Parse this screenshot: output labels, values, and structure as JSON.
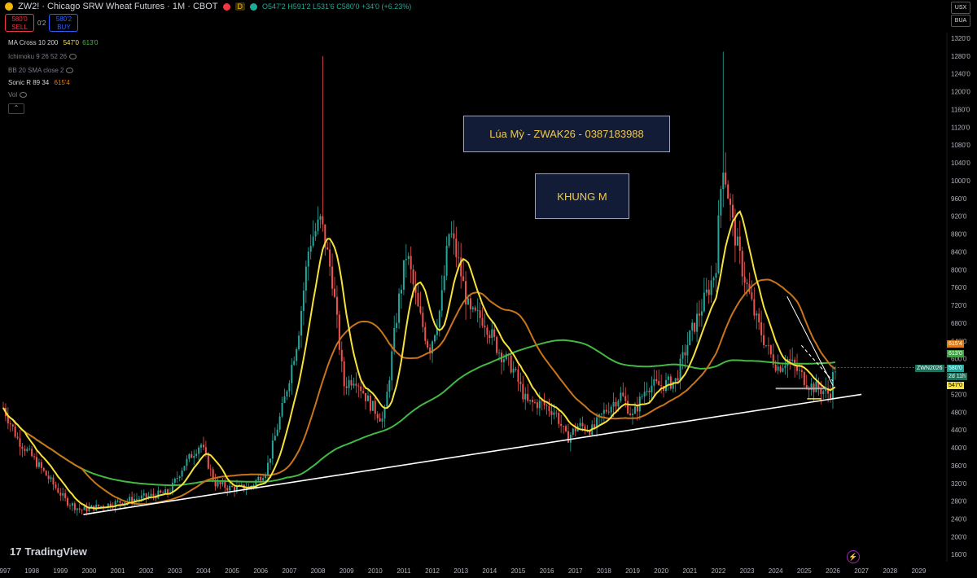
{
  "header": {
    "symbol": "ZW2! · Chicago SRW Wheat Futures · 1M · CBOT",
    "badge": "D",
    "ohlc": "O547'2 H591'2 L531'6 C580'0 +34'0 (+6.23%)"
  },
  "trade": {
    "sell_price": "580'0",
    "sell_label": "SELL",
    "spread": "0'2",
    "buy_price": "580'2",
    "buy_label": "BUY"
  },
  "indicators": [
    {
      "name": "MA Cross 10 200",
      "v1": "547'0",
      "v2": "613'0",
      "c1": "#f7e13b",
      "c2": "#43b845"
    },
    {
      "name": "Ichimoku 9 26 52 26",
      "v1": "",
      "v2": "",
      "c1": "",
      "c2": ""
    },
    {
      "name": "BB 20 SMA close 2",
      "v1": "",
      "v2": "",
      "c1": "",
      "c2": ""
    },
    {
      "name": "Sonic R 89 34",
      "v1": "615'4",
      "v2": "",
      "c1": "#e07b1a",
      "c2": ""
    },
    {
      "name": "Vol",
      "v1": "",
      "v2": "",
      "c1": "",
      "c2": ""
    }
  ],
  "annotations": {
    "title_box": "Lúa Mỳ - ZWAK26 - 0387183988",
    "timeframe_box": "KHUNG M"
  },
  "scale_controls": {
    "currency": "USX",
    "unit": "BUA"
  },
  "price_labels": {
    "sonic": "615'4",
    "ma200": "613'0",
    "symbol_tag": "ZWN2026",
    "last": "580'0",
    "countdown": "2d 11h",
    "ma10": "547'0"
  },
  "branding": {
    "logo": "TradingView",
    "logo_mark": "17"
  },
  "colors": {
    "up": "#26a69a",
    "down": "#ef5350",
    "ma10": "#f7e13b",
    "ma200": "#43b845",
    "sonic": "#c8741b",
    "trend": "#ffffff"
  },
  "chart_data": {
    "type": "line",
    "title": "Chicago SRW Wheat Futures · 1M · CBOT",
    "ylabel": "USX/BUA",
    "ylim": [
      1300,
      13400
    ],
    "xlim": [
      1997.0,
      2029.9
    ],
    "y_ticks": [
      "1320'0",
      "1280'0",
      "1240'0",
      "1200'0",
      "1160'0",
      "1120'0",
      "1080'0",
      "1040'0",
      "1000'0",
      "960'0",
      "920'0",
      "880'0",
      "840'0",
      "800'0",
      "760'0",
      "720'0",
      "680'0",
      "640'0",
      "600'0",
      "560'0",
      "520'0",
      "480'0",
      "440'0",
      "400'0",
      "360'0",
      "320'0",
      "280'0",
      "240'0",
      "200'0",
      "160'0"
    ],
    "y_tick_values": [
      13200,
      12800,
      12400,
      12000,
      11600,
      11200,
      10800,
      10400,
      10000,
      9600,
      9200,
      8800,
      8400,
      8000,
      7600,
      7200,
      6800,
      6400,
      6000,
      5600,
      5200,
      4800,
      4400,
      4000,
      3600,
      3200,
      2800,
      2400,
      2000,
      1600
    ],
    "x_ticks": [
      "1997",
      "1998",
      "1999",
      "2000",
      "2001",
      "2002",
      "2003",
      "2004",
      "2005",
      "2006",
      "2007",
      "2008",
      "2009",
      "2010",
      "2011",
      "2012",
      "2013",
      "2014",
      "2015",
      "2016",
      "2017",
      "2018",
      "2019",
      "2020",
      "2021",
      "2022",
      "2023",
      "2024",
      "2025",
      "2026",
      "2027",
      "2028",
      "2029"
    ],
    "x_tick_values": [
      1997,
      1998,
      1999,
      2000,
      2001,
      2002,
      2003,
      2004,
      2005,
      2006,
      2007,
      2008,
      2009,
      2010,
      2011,
      2012,
      2013,
      2014,
      2015,
      2016,
      2017,
      2018,
      2019,
      2020,
      2021,
      2022,
      2023,
      2024,
      2025,
      2026,
      2027,
      2028,
      2029
    ],
    "price_keyframes": {
      "x": [
        1997.0,
        1997.5,
        1998.0,
        1998.6,
        1999.2,
        1999.7,
        2000.5,
        2001.2,
        2002.0,
        2002.8,
        2003.3,
        2003.9,
        2004.4,
        2004.9,
        2005.6,
        2006.2,
        2006.8,
        2007.3,
        2007.7,
        2008.1,
        2008.5,
        2008.9,
        2009.3,
        2009.8,
        2010.3,
        2010.8,
        2011.1,
        2011.5,
        2011.9,
        2012.3,
        2012.6,
        2012.9,
        2013.3,
        2013.8,
        2014.3,
        2014.8,
        2015.3,
        2015.8,
        2016.3,
        2016.7,
        2017.1,
        2017.6,
        2018.0,
        2018.6,
        2019.0,
        2019.5,
        2020.0,
        2020.5,
        2021.0,
        2021.5,
        2021.9,
        2022.15,
        2022.5,
        2022.8,
        2023.3,
        2023.8,
        2024.1,
        2024.4,
        2024.8,
        2025.2,
        2025.6,
        2025.9,
        2026.05
      ],
      "y": [
        4900,
        4200,
        3800,
        3300,
        2800,
        2600,
        2700,
        2800,
        2900,
        3000,
        3600,
        4100,
        3200,
        3100,
        3100,
        3500,
        5000,
        6500,
        8600,
        9100,
        7800,
        5400,
        5600,
        5000,
        4600,
        7200,
        8400,
        7100,
        6200,
        7200,
        8900,
        8200,
        7000,
        6900,
        6200,
        5800,
        5000,
        5000,
        4800,
        4200,
        4500,
        4400,
        4800,
        5200,
        4700,
        5400,
        5400,
        5500,
        6500,
        7300,
        8000,
        10500,
        9000,
        8100,
        6900,
        6100,
        5800,
        6000,
        5700,
        5400,
        5300,
        5200,
        5800
      ]
    },
    "series": [
      {
        "name": "MA Cross 10 200",
        "values": [
          5470,
          6130
        ]
      },
      {
        "name": "Sonic R 89 34",
        "values": [
          6154
        ]
      }
    ],
    "last_price": 5800,
    "ma10_last": 5470,
    "ma200_last": 6130,
    "sonic_last": 6154,
    "trendline": {
      "x": [
        1999.8,
        2027.0
      ],
      "y": [
        2500,
        5200
      ]
    },
    "grid": false,
    "legend": "top-left"
  }
}
